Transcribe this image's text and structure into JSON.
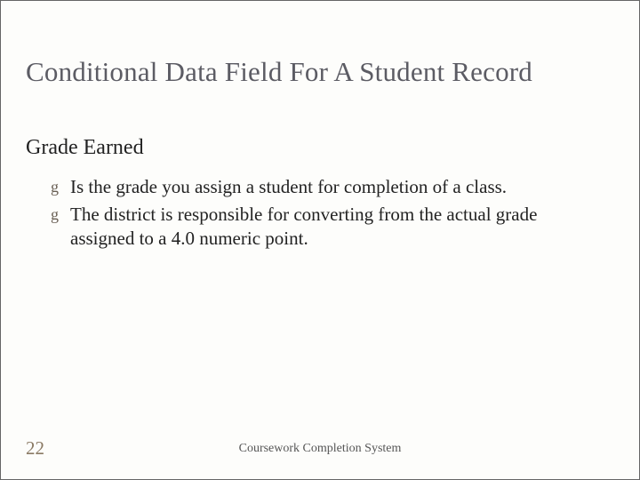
{
  "slide": {
    "title": "Conditional Data Field For A Student Record",
    "subheading": "Grade Earned",
    "bullets": [
      "Is  the grade you assign a student for completion of a class.",
      "The district is responsible for converting from the actual grade assigned to a 4.0 numeric point."
    ],
    "bullet_glyph": "g",
    "page_number": "22",
    "footer": "Coursework Completion System"
  }
}
